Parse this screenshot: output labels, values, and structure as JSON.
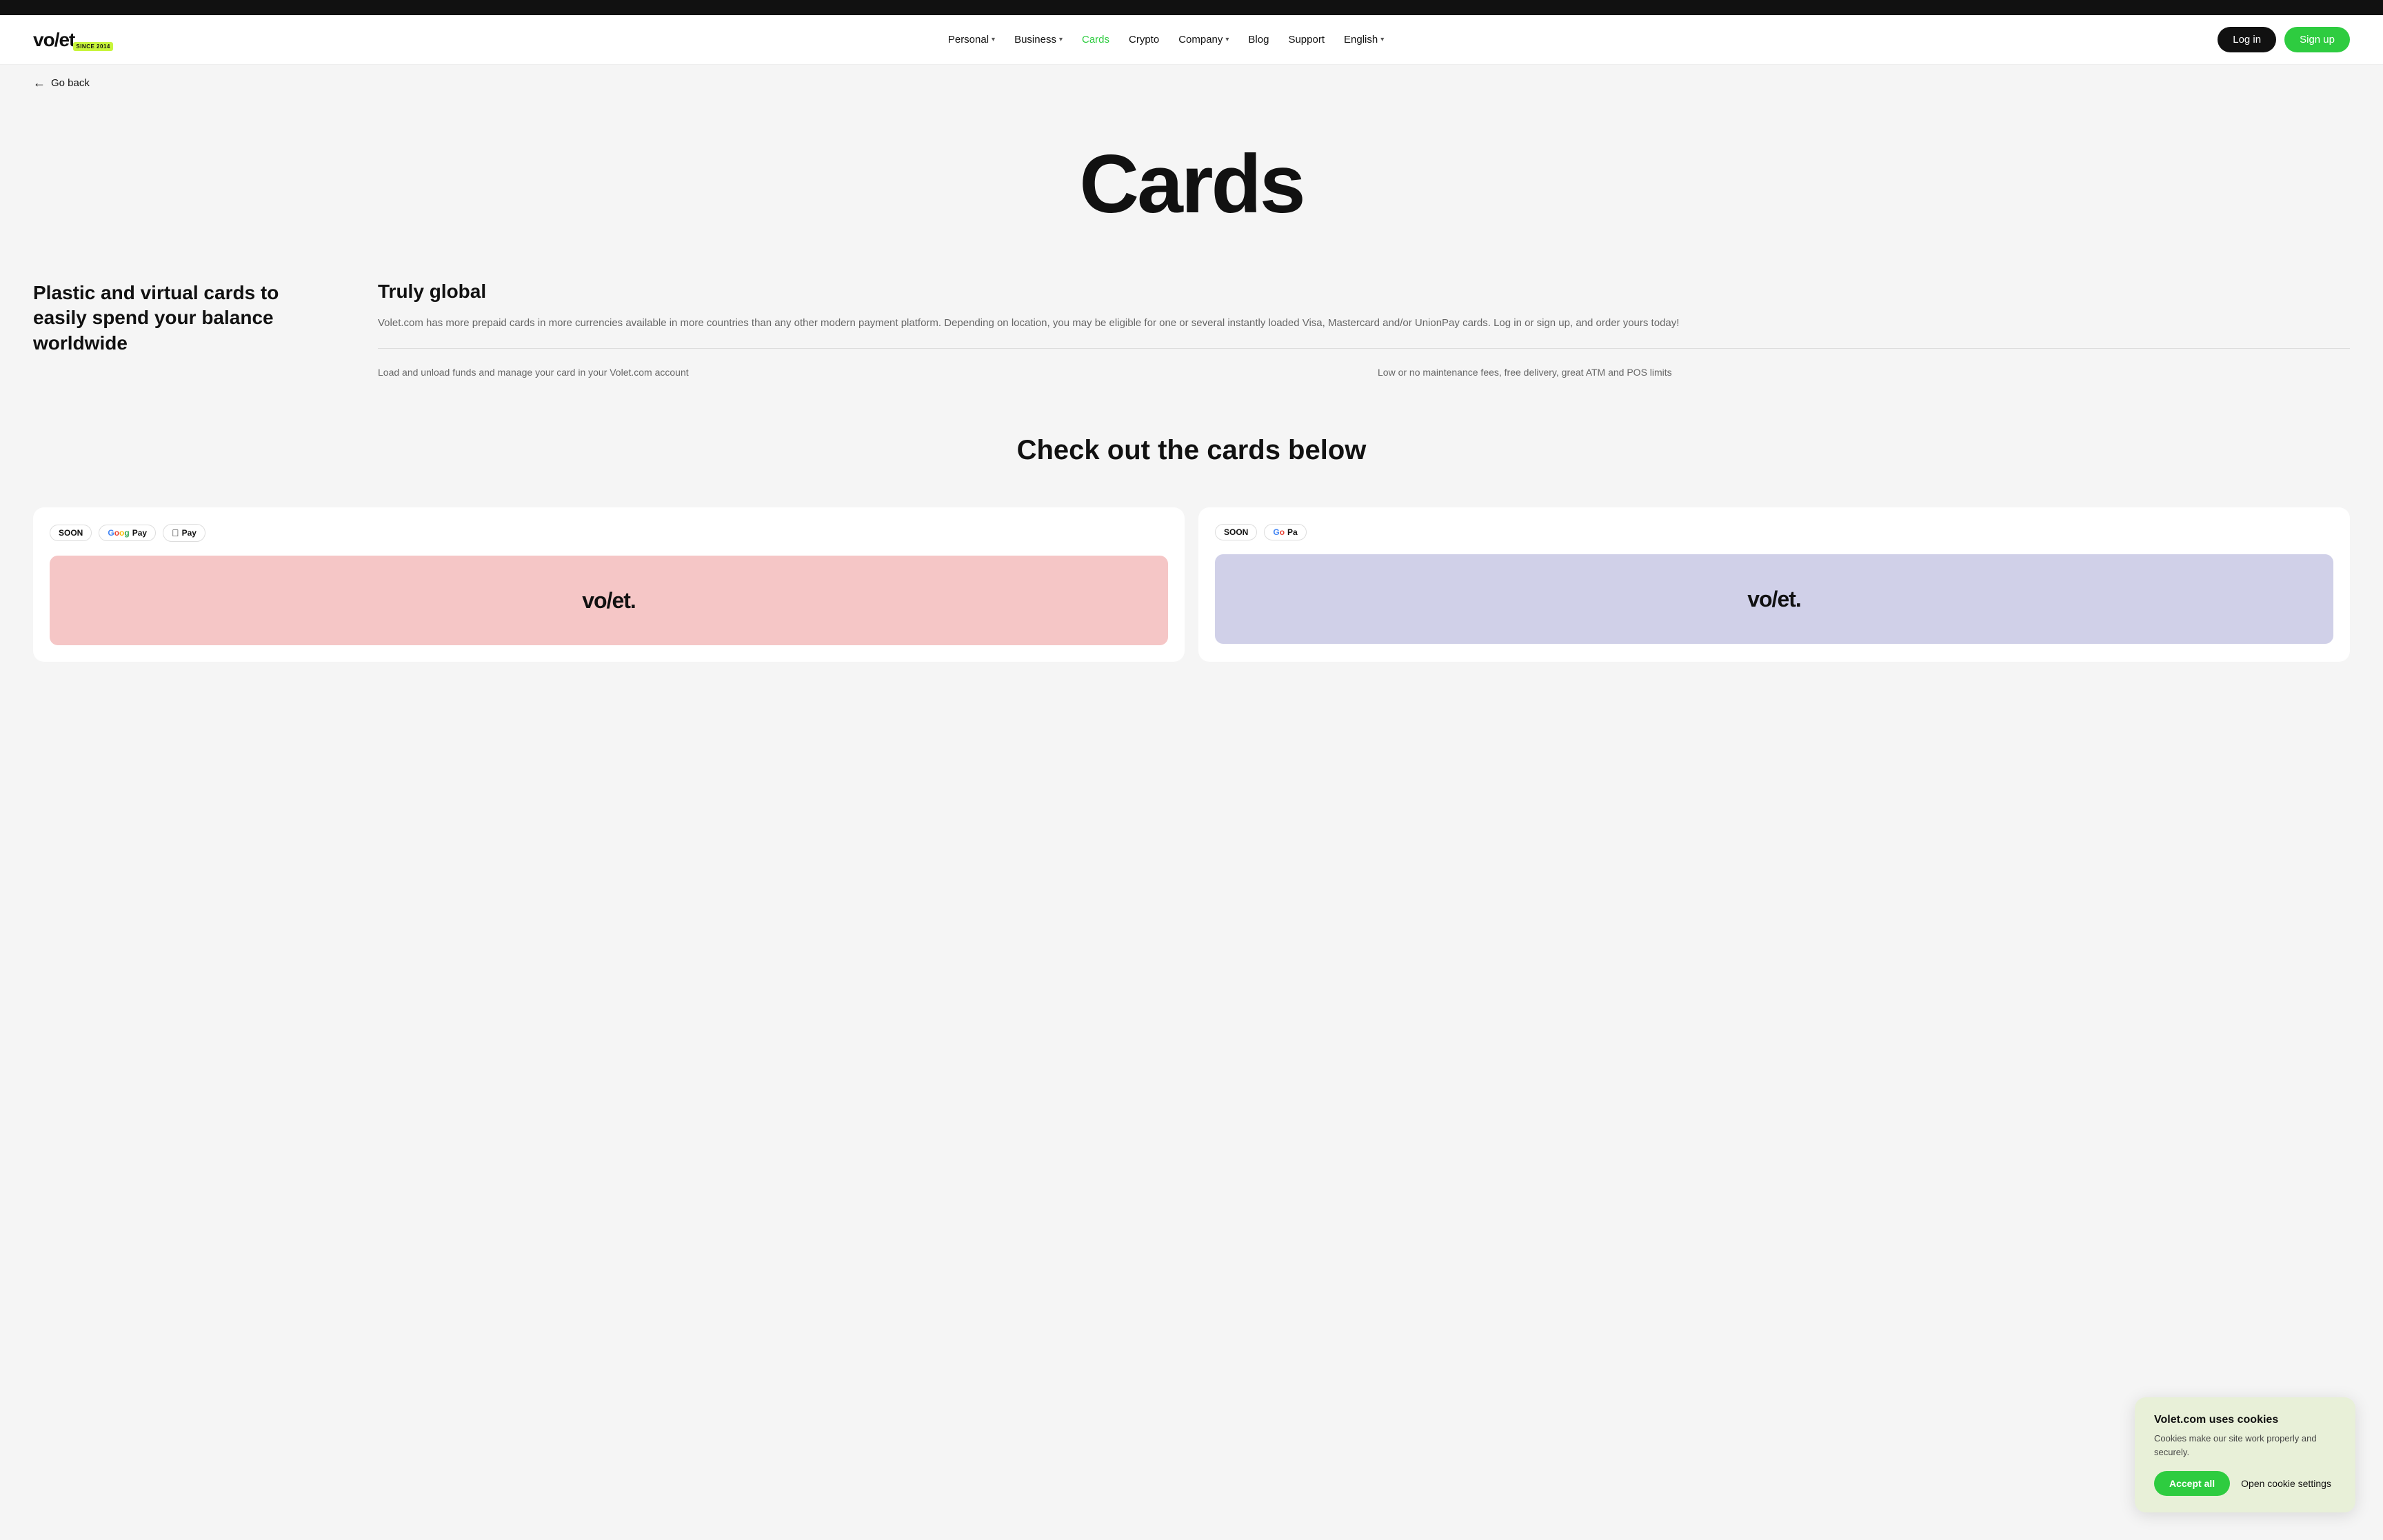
{
  "topBar": {},
  "header": {
    "logo": {
      "text": "vo/et",
      "badge": "SINCE 2014"
    },
    "nav": {
      "items": [
        {
          "label": "Personal",
          "hasDropdown": true,
          "active": false
        },
        {
          "label": "Business",
          "hasDropdown": true,
          "active": false
        },
        {
          "label": "Cards",
          "hasDropdown": false,
          "active": true
        },
        {
          "label": "Crypto",
          "hasDropdown": false,
          "active": false
        },
        {
          "label": "Company",
          "hasDropdown": true,
          "active": false
        },
        {
          "label": "Blog",
          "hasDropdown": false,
          "active": false
        },
        {
          "label": "Support",
          "hasDropdown": false,
          "active": false
        },
        {
          "label": "English",
          "hasDropdown": true,
          "active": false
        }
      ],
      "loginLabel": "Log in",
      "signupLabel": "Sign up"
    }
  },
  "goBack": {
    "label": "Go back"
  },
  "hero": {
    "title": "Cards"
  },
  "contentSection": {
    "leftTitle": "Plastic and virtual cards to easily spend your balance worldwide",
    "rightTitle": "Truly global",
    "rightDesc": "Volet.com has more prepaid cards in more currencies available in more countries than any other modern payment platform. Depending on location, you may be eligible for one or several instantly loaded Visa, Mastercard and/or UnionPay cards. Log in or sign up, and order yours today!",
    "feature1": "Load and unload funds and manage your card in your Volet.com account",
    "feature2": "Low or no maintenance fees, free delivery, great ATM and POS limits"
  },
  "checkSection": {
    "title": "Check out the cards below"
  },
  "cards": [
    {
      "badges": [
        "SOON",
        "G Pay",
        "Apple Pay"
      ],
      "previewType": "pink",
      "logoText": "vo/et."
    },
    {
      "badges": [
        "SOON",
        "G Pa"
      ],
      "previewType": "lavender",
      "logoText": "vo/et."
    }
  ],
  "cookie": {
    "title": "Volet.com uses cookies",
    "description": "Cookies make our site work properly and securely.",
    "acceptLabel": "Accept all",
    "settingsLabel": "Open cookie settings"
  }
}
